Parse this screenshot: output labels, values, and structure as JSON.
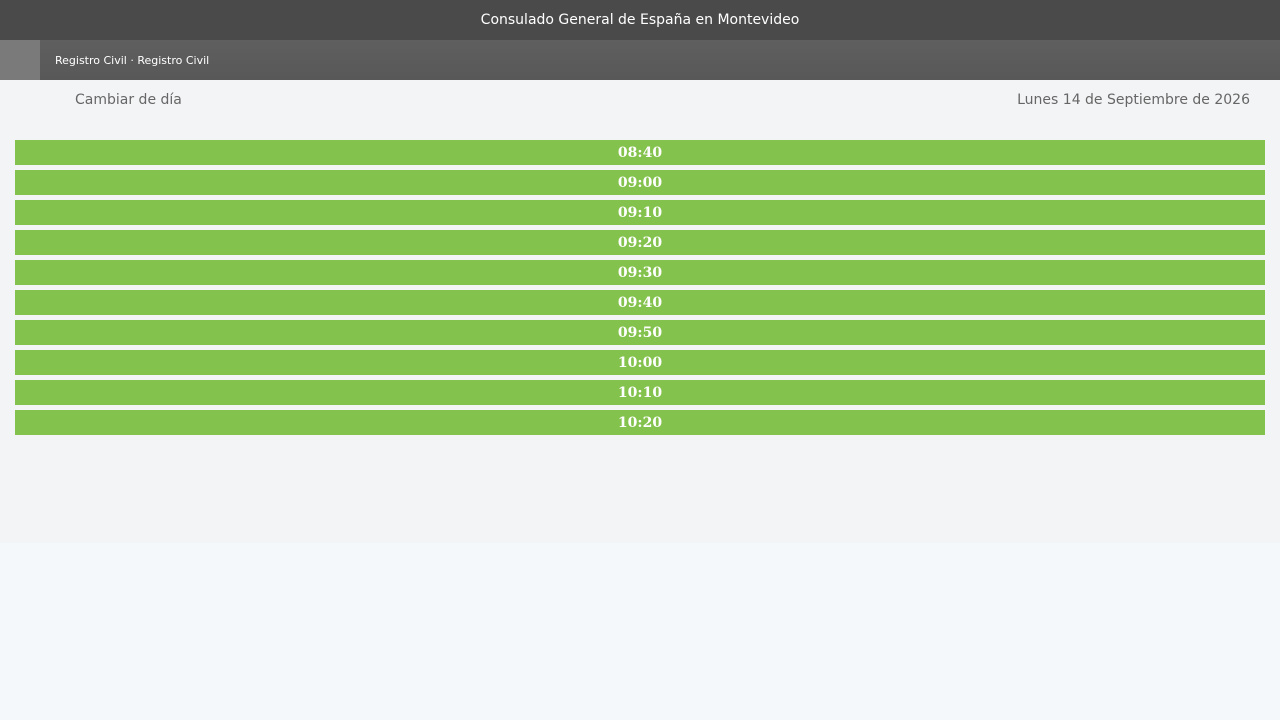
{
  "header": {
    "title": "Consulado General de España en Montevideo"
  },
  "breadcrumb": {
    "text": "Registro Civil · Registro Civil"
  },
  "day_selector": {
    "change_label": "Cambiar de día",
    "date_label": "Lunes 14 de Septiembre de 2026"
  },
  "slots": [
    "08:40",
    "09:00",
    "09:10",
    "09:20",
    "09:30",
    "09:40",
    "09:50",
    "10:00",
    "10:10",
    "10:20"
  ],
  "colors": {
    "slot_available": "#84c24e",
    "header_bg": "#4a4a4a"
  }
}
